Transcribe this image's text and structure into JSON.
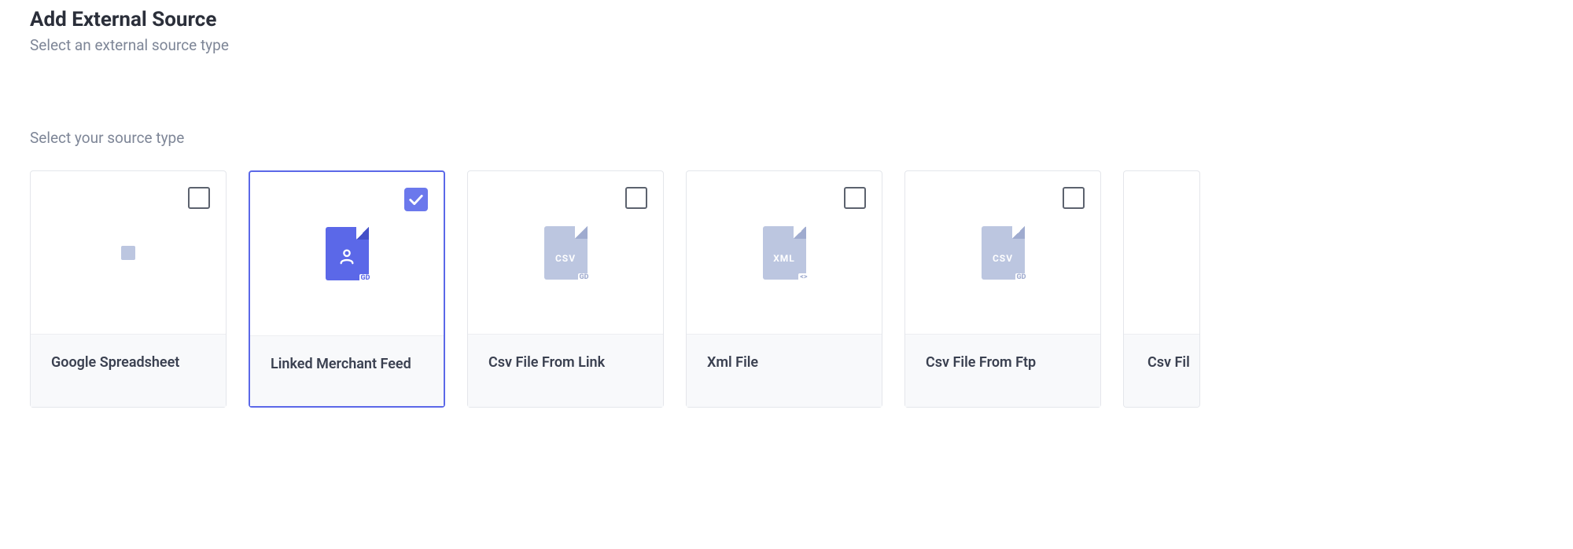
{
  "header": {
    "title": "Add External Source",
    "subtitle": "Select an external source type"
  },
  "section": {
    "label": "Select your source type"
  },
  "cards": [
    {
      "label": "Google Spreadsheet",
      "icon": "spreadsheet",
      "selected": false
    },
    {
      "label": "Linked Merchant Feed",
      "icon": "person-file",
      "selected": true
    },
    {
      "label": "Csv File From Link",
      "icon": "csv-file",
      "selected": false
    },
    {
      "label": "Xml File",
      "icon": "xml-file",
      "selected": false
    },
    {
      "label": "Csv File From Ftp",
      "icon": "csv-file",
      "selected": false
    },
    {
      "label": "Csv Fil",
      "icon": "none",
      "selected": false,
      "partial": true
    }
  ]
}
